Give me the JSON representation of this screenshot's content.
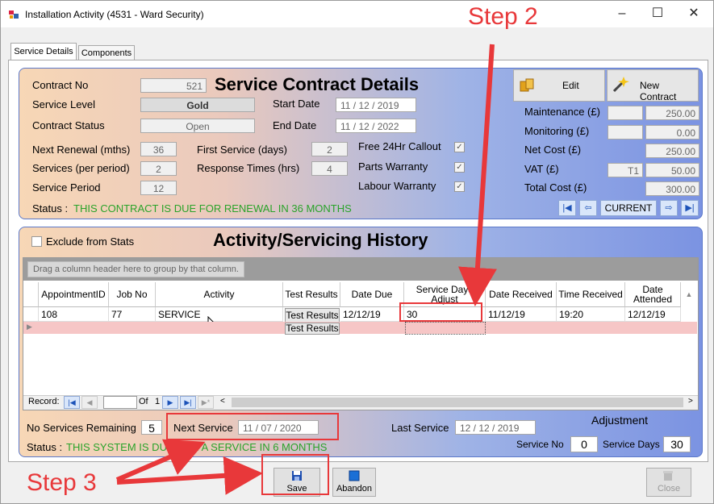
{
  "window": {
    "title": "Installation Activity (4531 - Ward Security)",
    "minimize": "–",
    "maximize": "☐",
    "close": "✕"
  },
  "tabs": [
    {
      "label": "Service Details"
    },
    {
      "label": "Components"
    }
  ],
  "contract": {
    "heading": "Service Contract Details",
    "contract_no_label": "Contract No",
    "contract_no": "521",
    "service_level_label": "Service Level",
    "service_level": "Gold",
    "contract_status_label": "Contract Status",
    "contract_status": "Open",
    "start_date_label": "Start Date",
    "start_date": "11 / 12 / 2019",
    "end_date_label": "End Date",
    "end_date": "11 / 12 / 2022",
    "next_renewal_label": "Next Renewal (mths)",
    "next_renewal": "36",
    "services_per_period_label": "Services (per period)",
    "services_per_period": "2",
    "service_period_label": "Service Period",
    "service_period": "12",
    "first_service_label": "First Service (days)",
    "first_service": "2",
    "response_times_label": "Response Times (hrs)",
    "response_times": "4",
    "free_callout_label": "Free 24Hr Callout",
    "parts_warranty_label": "Parts Warranty",
    "labour_warranty_label": "Labour Warranty",
    "check_mark": "✓",
    "status_label": "Status :",
    "status_text": "THIS CONTRACT IS DUE FOR RENEWAL IN 36 MONTHS",
    "edit_label": "Edit",
    "new_contract_label": "New Contract",
    "maintenance_label": "Maintenance (£)",
    "maintenance": "250.00",
    "monitoring_label": "Monitoring (£)",
    "monitoring": "0.00",
    "net_cost_label": "Net Cost (£)",
    "net_cost": "250.00",
    "vat_label": "VAT (£)",
    "vat_code": "T1",
    "vat": "50.00",
    "total_cost_label": "Total Cost (£)",
    "total_cost": "300.00",
    "nav_current": "CURRENT"
  },
  "history": {
    "heading": "Activity/Servicing History",
    "exclude_label": "Exclude from Stats",
    "group_hint": "Drag a column header here to group by that column.",
    "columns": [
      "AppointmentID",
      "Job No",
      "Activity",
      "Test Results",
      "Date Due",
      "Service Days Adjust",
      "Date Received",
      "Time Received",
      "Date Attended"
    ],
    "row": {
      "appointment_id": "108",
      "job_no": "77",
      "activity": "SERVICE",
      "test_results": "Test Results",
      "date_due": "12/12/19",
      "service_days_adjust": "30",
      "date_received": "11/12/19",
      "time_received": "19:20",
      "date_attended": "12/12/19"
    },
    "new_row_test_results": "Test Results",
    "record_label": "Record:",
    "of_label": "Of",
    "record_total": "1",
    "no_services_label": "No Services Remaining",
    "no_services": "5",
    "next_service_label": "Next Service",
    "next_service": "11 / 07 / 2020",
    "last_service_label": "Last Service",
    "last_service": "12 / 12 / 2019",
    "adjustment_label": "Adjustment",
    "service_no_label": "Service No",
    "service_no": "0",
    "service_days_label": "Service Days",
    "service_days": "30",
    "status_label": "Status :",
    "status_text": "THIS SYSTEM IS DUE FOR A SERVICE IN 6 MONTHS"
  },
  "footer": {
    "save": "Save",
    "abandon": "Abandon",
    "close": "Close"
  },
  "annotations": {
    "step2": "Step 2",
    "step3": "Step 3"
  },
  "colors": {
    "accent_red": "#e8383a",
    "status_green": "#2aa32a"
  }
}
